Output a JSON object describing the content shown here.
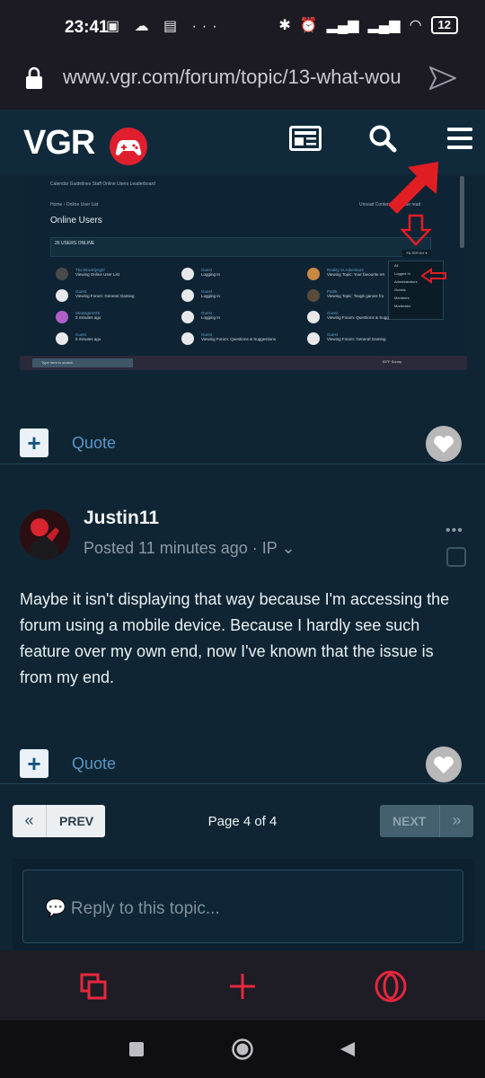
{
  "status_bar": {
    "time": "23:41",
    "left_icons": [
      "sim-icon",
      "cloud-icon",
      "calendar-icon",
      "more-dots-icon"
    ],
    "right_icons": [
      "bluetooth-icon",
      "alarm-icon",
      "signal-icon",
      "signal-icon",
      "wifi-icon"
    ],
    "battery": "12"
  },
  "browser": {
    "url": "www.vgr.com/forum/topic/13-what-wou"
  },
  "site_header": {
    "logo_text": "VGR"
  },
  "embedded_screenshot": {
    "nav": "Calendar    Guidelines    Staff    Online Users    Leaderboard",
    "breadcrumb": "Home › Online User List",
    "title": "Online Users",
    "unread": "Unread Content   Mark site read",
    "users_online": "26 USERS ONLINE",
    "filter_label": "FILTER BY ▾",
    "filter_options": [
      "All",
      "Logged In",
      "Administrators",
      "Guests",
      "Members",
      "Moderator"
    ],
    "users": [
      {
        "name": "The Brooklyngirl",
        "line": "Viewing Online User List"
      },
      {
        "name": "Guest",
        "line": "Logging In"
      },
      {
        "name": "Reality vs Adventure",
        "line": "Viewing Topic: Your favourite ret"
      },
      {
        "name": "Guest",
        "line": "Viewing Forum: General Gaming"
      },
      {
        "name": "Guest",
        "line": "Logging In"
      },
      {
        "name": "Patrik",
        "line": "Viewing Topic: Tough games fro"
      },
      {
        "name": "StewageretOr",
        "line": "3 minutes ago"
      },
      {
        "name": "Guest",
        "line": "Logging In"
      },
      {
        "name": "Guest",
        "line": "Viewing Forum: Questions & Sugg"
      },
      {
        "name": "Guest",
        "line": "5 minutes ago"
      },
      {
        "name": "Guest",
        "line": "Viewing Forum: Questions & Suggestions"
      },
      {
        "name": "Guest",
        "line": "Viewing Forum: General Gaming"
      }
    ],
    "taskbar_search": "Type here to search",
    "weather": "53°F Sunny"
  },
  "post1": {
    "quote_label": "Quote"
  },
  "post2": {
    "author": "Justin11",
    "posted": "Posted 11 minutes ago · IP ⌄",
    "more": "•••",
    "body": "Maybe it isn't displaying that way because I'm accessing the forum using a mobile device. Because I hardly see such feature over my own end, now I've known that the issue is from my end.",
    "quote_label": "Quote"
  },
  "pagination": {
    "prev_label": "PREV",
    "prev_icon": "«",
    "page_info": "Page 4 of 4",
    "next_label": "NEXT",
    "next_icon": "»"
  },
  "reply": {
    "placeholder": "💬 Reply to this topic..."
  },
  "colors": {
    "brand_red": "#e01f2e",
    "background": "#0f2533",
    "link_blue": "#5b96c8"
  }
}
